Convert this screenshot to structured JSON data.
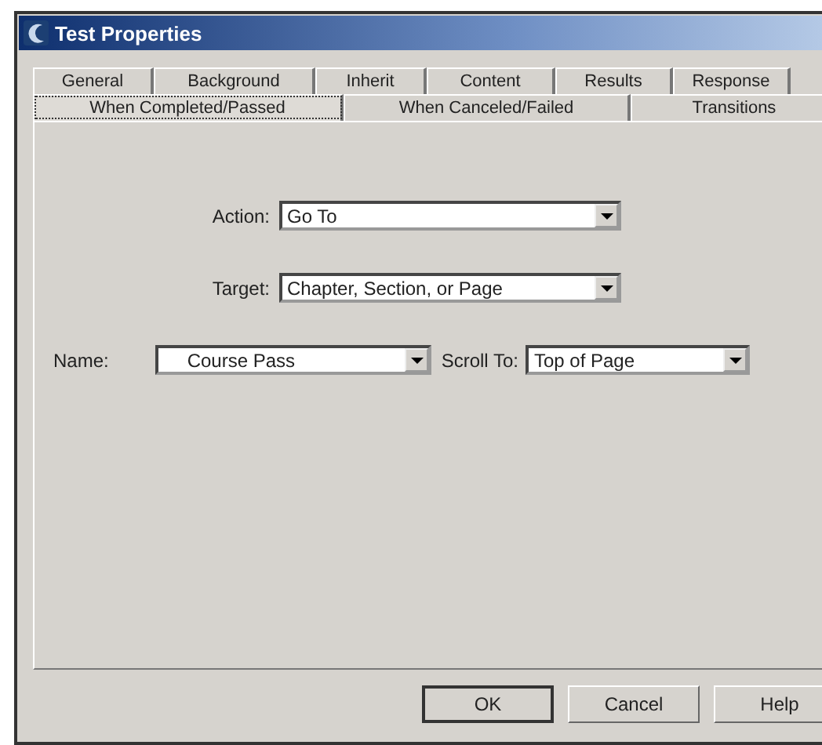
{
  "window": {
    "title": "Test Properties"
  },
  "tab_rows": [
    [
      {
        "label": "General",
        "selected": false
      },
      {
        "label": "Background",
        "selected": false
      },
      {
        "label": "Inherit",
        "selected": false
      },
      {
        "label": "Content",
        "selected": false
      },
      {
        "label": "Results",
        "selected": false
      },
      {
        "label": "Response",
        "selected": false
      }
    ],
    [
      {
        "label": "When Completed/Passed",
        "selected": true
      },
      {
        "label": "When Canceled/Failed",
        "selected": false
      },
      {
        "label": "Transitions",
        "selected": false
      }
    ]
  ],
  "fields": [
    {
      "label": "Action:",
      "value": "Go To"
    },
    {
      "label": "Target:",
      "value": "Chapter, Section, or Page"
    },
    {
      "label": "Name:",
      "value": "Course Pass"
    },
    {
      "label": "Scroll To:",
      "value": "Top of Page"
    }
  ],
  "buttons": [
    {
      "label": "OK",
      "default": true
    },
    {
      "label": "Cancel",
      "default": false
    },
    {
      "label": "Help",
      "default": false
    }
  ]
}
